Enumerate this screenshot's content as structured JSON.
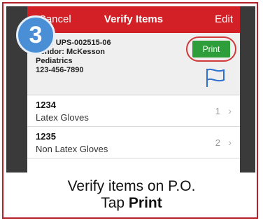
{
  "step_number": "3",
  "navbar": {
    "left": "Cancel",
    "title": "Verify Items",
    "right": "Edit"
  },
  "po": {
    "number": "PO#: UPS-002515-06",
    "vendor": "Vendor: McKesson",
    "department": "Pediatrics",
    "phone": "123-456-7890",
    "print_label": "Print",
    "flag_icon": "flag-icon"
  },
  "items": [
    {
      "code": "1234",
      "name": "Latex Gloves",
      "qty": "1"
    },
    {
      "code": "1235",
      "name": "Non Latex Gloves",
      "qty": "2"
    }
  ],
  "caption": {
    "line1": "Verify items on P.O.",
    "line2_prefix": "Tap ",
    "line2_bold": "Print"
  },
  "colors": {
    "frame": "#b3222a",
    "navbar": "#d31f26",
    "print_button": "#2e9e3a",
    "badge": "#4a8fd6",
    "flag": "#2f6fd0"
  }
}
